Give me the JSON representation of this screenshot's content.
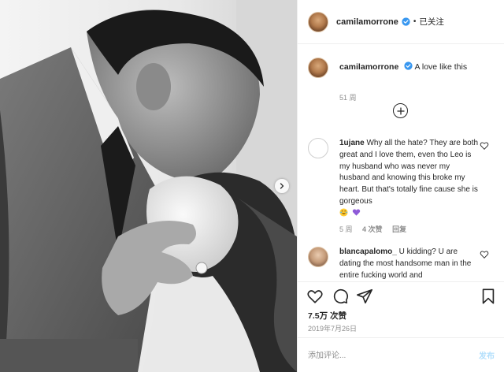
{
  "header": {
    "username": "camilamorrone",
    "dot": "•",
    "follow_label": "已关注"
  },
  "caption": {
    "username": "camilamorrone",
    "text": "A love like this",
    "time": "51 周"
  },
  "comments": [
    {
      "username": "1ujane",
      "text": "Why all the hate? They are both great and I love them, even tho Leo is my husband who was never my husband and knowing this broke my heart. But that's totally fine cause she is gorgeous",
      "emojis": [
        "crying-laughing-emoji",
        "purple-heart-emoji"
      ],
      "time": "5 周",
      "likes": "4 次赞",
      "reply": "回复"
    },
    {
      "username": "blancapalomo_",
      "text": "U kidding? U are dating the most handsome man in the entire fucking world and",
      "time": "",
      "likes": "",
      "reply": ""
    }
  ],
  "footer": {
    "likes": "7.5万 次赞",
    "date": "2019年7月26日",
    "comment_placeholder": "添加评论...",
    "post_label": "发布"
  },
  "icons": {
    "heart": "heart-icon",
    "comment": "comment-icon",
    "share": "share-icon",
    "save": "bookmark-icon",
    "verified": "verified-badge-icon",
    "plus": "plus-circle-icon",
    "next": "chevron-right-icon"
  },
  "colors": {
    "verified": "#3897f0",
    "post_disabled": "#b2dffc",
    "muted": "#8e8e8e"
  }
}
